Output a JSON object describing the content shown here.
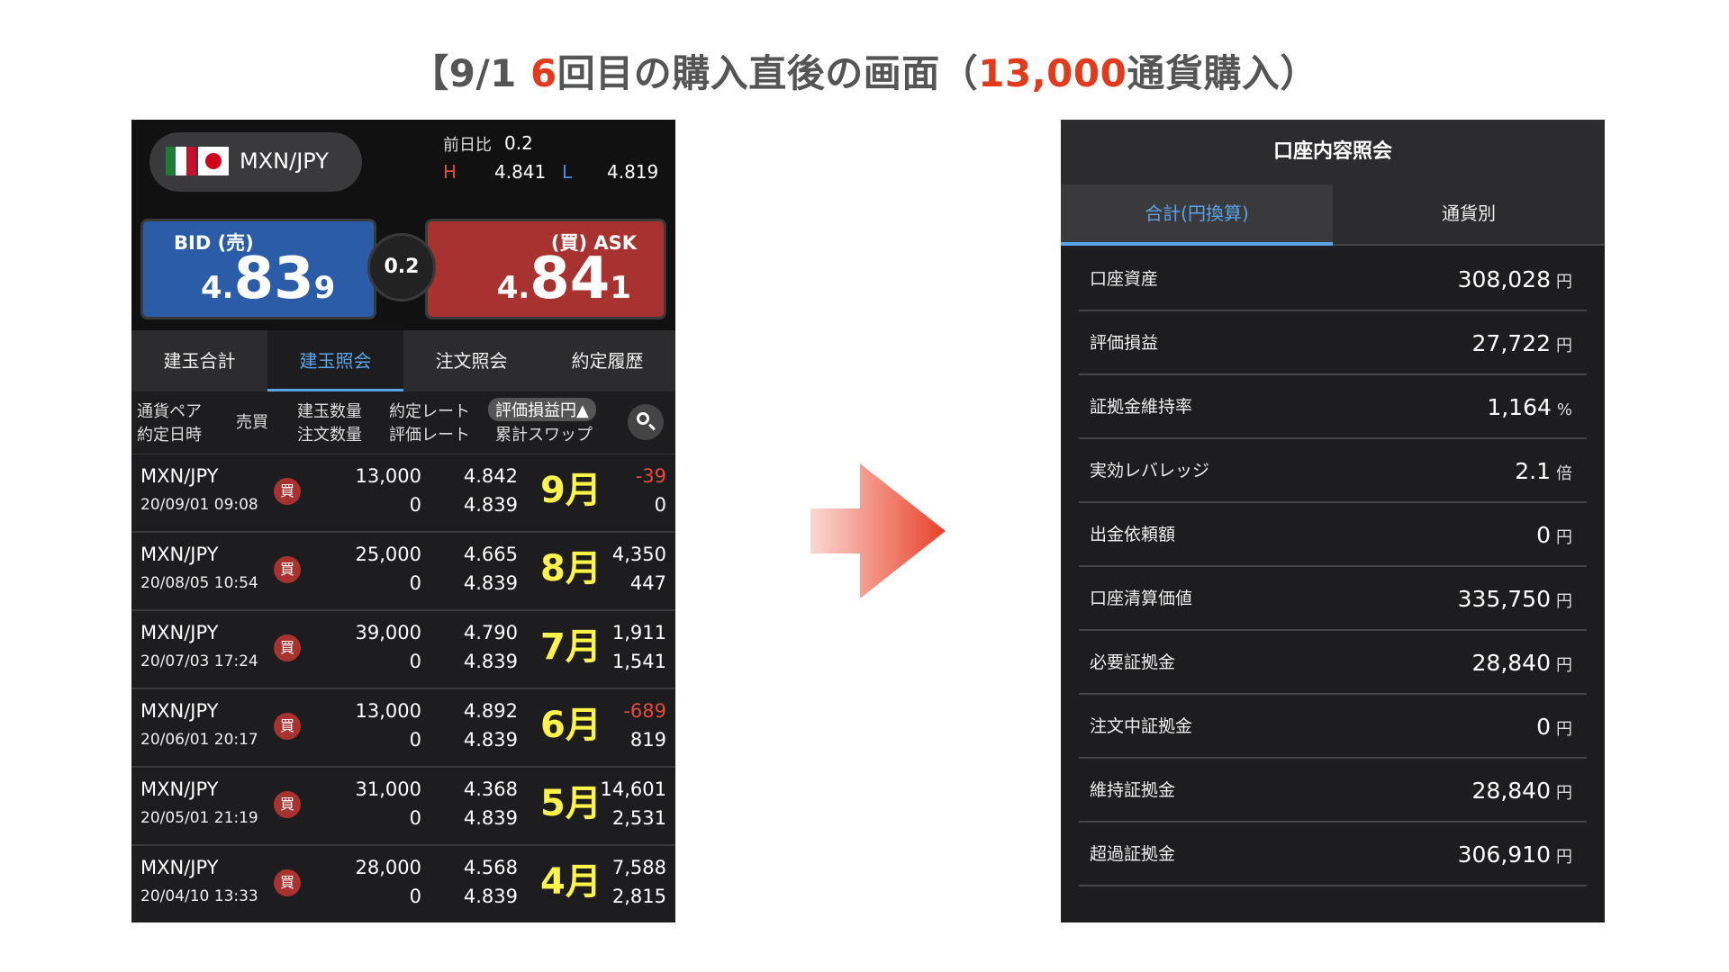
{
  "heading": {
    "part1": "【9/1 ",
    "part2": "6",
    "part3": "回目の購入直後の画面（",
    "part4": "13,000",
    "part5": "通貨購入）"
  },
  "colors": {
    "accent_red": "#e23a1a",
    "tab_blue": "#5aa3e6",
    "month_yellow": "#fff34a",
    "bid_blue": "#2a5ca8",
    "ask_red": "#a8322f"
  },
  "left_panel": {
    "pair": "MXN/JPY",
    "change_label": "前日比",
    "change_value": "0.2",
    "high_label": "H",
    "high_value": "4.841",
    "low_label": "L",
    "low_value": "4.819",
    "bid": {
      "label": "BID (売)",
      "price_small": "4.",
      "price_big": "83",
      "price_last": "9"
    },
    "ask": {
      "label": "(買) ASK",
      "price_small": "4.",
      "price_big": "84",
      "price_last": "1"
    },
    "spread": "0.2",
    "tabs": [
      "建玉合計",
      "建玉照会",
      "注文照会",
      "約定履歴"
    ],
    "active_tab": "建玉照会",
    "columns": {
      "pair_top": "通貨ペア",
      "pair_bottom": "約定日時",
      "side": "売買",
      "qty_top": "建玉数量",
      "qty_bottom": "注文数量",
      "rate_top": "約定レート",
      "rate_bottom": "評価レート",
      "pl_top": "評価損益円▲",
      "pl_bottom": "累計スワップ"
    },
    "positions": [
      {
        "pair": "MXN/JPY",
        "date": "20/09/01 09:08",
        "side": "買",
        "qty": "13,000",
        "order_qty": "0",
        "rate": "4.842",
        "eval_rate": "4.839",
        "month": "9月",
        "pl": "-39",
        "pl_color": "#e84a3b",
        "swap": "0"
      },
      {
        "pair": "MXN/JPY",
        "date": "20/08/05 10:54",
        "side": "買",
        "qty": "25,000",
        "order_qty": "0",
        "rate": "4.665",
        "eval_rate": "4.839",
        "month": "8月",
        "pl": "4,350",
        "pl_color": "#ffffff",
        "swap": "447"
      },
      {
        "pair": "MXN/JPY",
        "date": "20/07/03 17:24",
        "side": "買",
        "qty": "39,000",
        "order_qty": "0",
        "rate": "4.790",
        "eval_rate": "4.839",
        "month": "7月",
        "pl": "1,911",
        "pl_color": "#ffffff",
        "swap": "1,541"
      },
      {
        "pair": "MXN/JPY",
        "date": "20/06/01 20:17",
        "side": "買",
        "qty": "13,000",
        "order_qty": "0",
        "rate": "4.892",
        "eval_rate": "4.839",
        "month": "6月",
        "pl": "-689",
        "pl_color": "#e84a3b",
        "swap": "819"
      },
      {
        "pair": "MXN/JPY",
        "date": "20/05/01 21:19",
        "side": "買",
        "qty": "31,000",
        "order_qty": "0",
        "rate": "4.368",
        "eval_rate": "4.839",
        "month": "5月",
        "pl": "14,601",
        "pl_color": "#ffffff",
        "swap": "2,531"
      },
      {
        "pair": "MXN/JPY",
        "date": "20/04/10 13:33",
        "side": "買",
        "qty": "28,000",
        "order_qty": "0",
        "rate": "4.568",
        "eval_rate": "4.839",
        "month": "4月",
        "pl": "7,588",
        "pl_color": "#ffffff",
        "swap": "2,815"
      }
    ]
  },
  "right_panel": {
    "title": "口座内容照会",
    "tabs": [
      "合計(円換算)",
      "通貨別"
    ],
    "active_tab": "合計(円換算)",
    "rows": [
      {
        "label": "口座資産",
        "value": "308,028",
        "unit": "円"
      },
      {
        "label": "評価損益",
        "value": "27,722",
        "unit": "円"
      },
      {
        "label": "証拠金維持率",
        "value": "1,164",
        "unit": "%"
      },
      {
        "label": "実効レバレッジ",
        "value": "2.1",
        "unit": "倍"
      },
      {
        "label": "出金依頼額",
        "value": "0",
        "unit": "円"
      },
      {
        "label": "口座清算価値",
        "value": "335,750",
        "unit": "円"
      },
      {
        "label": "必要証拠金",
        "value": "28,840",
        "unit": "円"
      },
      {
        "label": "注文中証拠金",
        "value": "0",
        "unit": "円"
      },
      {
        "label": "維持証拠金",
        "value": "28,840",
        "unit": "円"
      },
      {
        "label": "超過証拠金",
        "value": "306,910",
        "unit": "円"
      }
    ]
  }
}
